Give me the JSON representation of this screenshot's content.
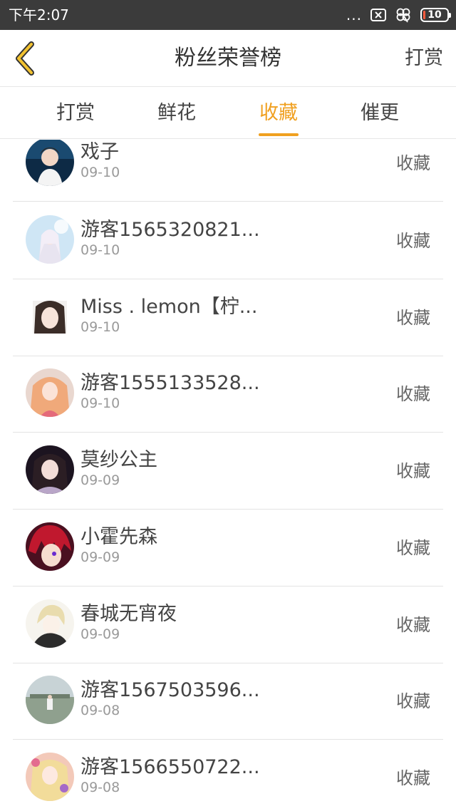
{
  "status_bar": {
    "time": "下午2:07",
    "icons": [
      "more-dots-icon",
      "sim-icon",
      "clover-icon",
      "battery-icon"
    ],
    "dots": "...",
    "battery": "10",
    "battery_low_color": "#ff5a3c"
  },
  "header": {
    "back_icon": "chevron-left-icon",
    "title": "粉丝荣誉榜",
    "action": "打赏"
  },
  "tabs": [
    {
      "label": "打赏",
      "active": false
    },
    {
      "label": "鲜花",
      "active": false
    },
    {
      "label": "收藏",
      "active": true
    },
    {
      "label": "催更",
      "active": false
    }
  ],
  "list": [
    {
      "name": "戏子",
      "date": "09-10",
      "action": "收藏"
    },
    {
      "name": "游客1565320821...",
      "date": "09-10",
      "action": "收藏"
    },
    {
      "name": "Miss . lemon【柠...",
      "date": "09-10",
      "action": "收藏"
    },
    {
      "name": "游客1555133528...",
      "date": "09-10",
      "action": "收藏"
    },
    {
      "name": "莫纱公主",
      "date": "09-09",
      "action": "收藏"
    },
    {
      "name": "小霍先森",
      "date": "09-09",
      "action": "收藏"
    },
    {
      "name": "春城无宵夜",
      "date": "09-09",
      "action": "收藏"
    },
    {
      "name": "游客1567503596...",
      "date": "09-08",
      "action": "收藏"
    },
    {
      "name": "游客1566550722...",
      "date": "09-08",
      "action": "收藏"
    }
  ],
  "colors": {
    "accent": "#f0a020",
    "status_bar": "#3b3b3b",
    "divider": "#e3e3e3"
  }
}
